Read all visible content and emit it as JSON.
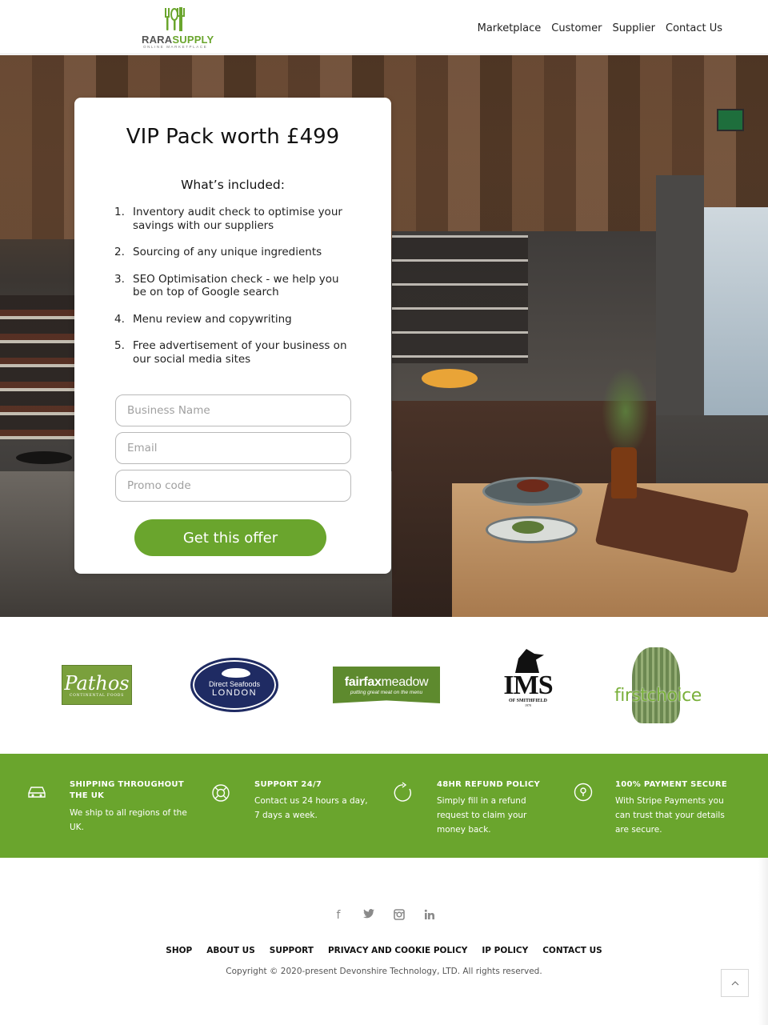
{
  "header": {
    "logo": {
      "name_part1": "RARA",
      "name_part2": "SUPPLY",
      "tagline": "ONLINE MARKETPLACE"
    },
    "nav": [
      "Marketplace",
      "Customer",
      "Supplier",
      "Contact Us"
    ]
  },
  "offer": {
    "title": "VIP Pack worth £499",
    "subtitle": "What’s included:",
    "items": [
      {
        "num": "1.",
        "text": "Inventory audit check to optimise your savings with our suppliers"
      },
      {
        "num": "2.",
        "text": "Sourcing of any unique ingredients"
      },
      {
        "num": "3.",
        "text": "SEO Optimisation check - we help you be on top of Google search"
      },
      {
        "num": "4.",
        "text": "Menu review and copywriting"
      },
      {
        "num": "5.",
        "text": "Free advertisement of your business on our social media sites"
      }
    ],
    "fields": {
      "business_name": {
        "placeholder": "Business Name",
        "value": ""
      },
      "email": {
        "placeholder": "Email",
        "value": ""
      },
      "promo": {
        "placeholder": "Promo code",
        "value": ""
      }
    },
    "cta": "Get this offer"
  },
  "brands": {
    "pathos": {
      "name": "Pathos",
      "sub": "CONTINENTAL FOODS"
    },
    "dsl": {
      "line1": "Direct Seafoods",
      "line2": "LONDON"
    },
    "fairfax": {
      "bold": "fairfax",
      "light": "meadow",
      "tagline": "putting great meat on the menu"
    },
    "ims": {
      "name": "IMS",
      "sub": "OF SMITHFIELD",
      "year": "1970"
    },
    "firstchoice": {
      "name": "firstchoice"
    }
  },
  "features": [
    {
      "icon": "car-icon",
      "title": "SHIPPING THROUGHOUT THE UK",
      "desc": "We ship to all regions of the UK."
    },
    {
      "icon": "lifebuoy-icon",
      "title": "SUPPORT 24/7",
      "desc": "Contact us 24 hours a day, 7 days a week."
    },
    {
      "icon": "refresh-icon",
      "title": "48HR REFUND POLICY",
      "desc": "Simply fill in a refund request to claim your money back."
    },
    {
      "icon": "lock-icon",
      "title": "100% PAYMENT SECURE",
      "desc": "With Stripe Payments you can trust that your details are secure."
    }
  ],
  "footer": {
    "social": [
      "facebook-icon",
      "twitter-icon",
      "instagram-icon",
      "linkedin-icon"
    ],
    "links": [
      "SHOP",
      "ABOUT US",
      "SUPPORT",
      "PRIVACY AND COOKIE POLICY",
      "IP POLICY",
      "CONTACT US"
    ],
    "copyright": "Copyright © 2020-present Devonshire Technology, LTD. All rights reserved."
  },
  "colors": {
    "brand_green": "#6aa52d",
    "text": "#222222"
  }
}
